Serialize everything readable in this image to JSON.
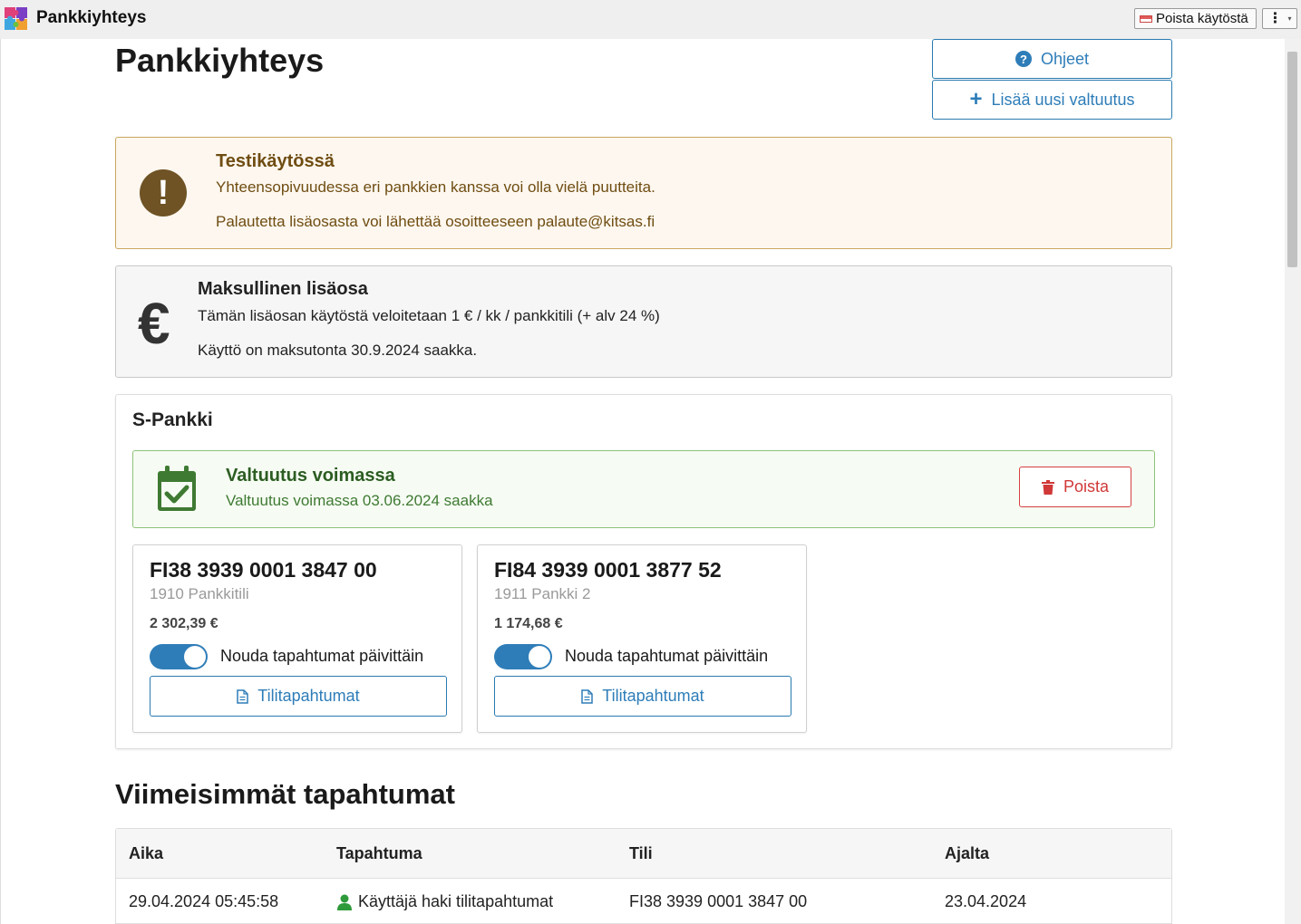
{
  "window": {
    "title": "Pankkiyhteys",
    "disable_label": "Poista käytöstä",
    "menu_dots": "⋮",
    "menu_caret": "▾"
  },
  "page": {
    "title": "Pankkiyhteys",
    "help_button": "Ohjeet",
    "add_button": "Lisää uusi valtuutus"
  },
  "warning": {
    "title": "Testikäytössä",
    "line1": "Yhteensopivuudessa eri pankkien kanssa voi olla vielä puutteita.",
    "line2": "Palautetta lisäosasta voi lähettää osoitteeseen palaute@kitsas.fi",
    "icon": "exclamation-icon",
    "icon_glyph": "!"
  },
  "info": {
    "title": "Maksullinen lisäosa",
    "line1": "Tämän lisäosan käytöstä veloitetaan 1 € / kk / pankkitili (+ alv 24 %)",
    "line2": "Käyttö on maksutonta 30.9.2024 saakka.",
    "icon": "euro-icon",
    "icon_glyph": "€"
  },
  "bank": {
    "name": "S-Pankki",
    "authorization": {
      "title": "Valtuutus voimassa",
      "subtitle": "Valtuutus voimassa 03.06.2024 saakka",
      "delete_label": "Poista"
    },
    "accounts": [
      {
        "iban": "FI38 3939 0001 3847 00",
        "name": "1910 Pankkitili",
        "balance": "2 302,39 €",
        "fetch_daily": true,
        "toggle_label": "Nouda tapahtumat päivittäin",
        "transactions_label": "Tilitapahtumat"
      },
      {
        "iban": "FI84 3939 0001 3877 52",
        "name": "1911 Pankki 2",
        "balance": "1 174,68 €",
        "fetch_daily": true,
        "toggle_label": "Nouda tapahtumat päivittäin",
        "transactions_label": "Tilitapahtumat"
      }
    ]
  },
  "events": {
    "title": "Viimeisimmät tapahtumat",
    "columns": [
      "Aika",
      "Tapahtuma",
      "Tili",
      "Ajalta"
    ],
    "rows": [
      {
        "time": "29.04.2024 05:45:58",
        "event": "Käyttäjä haki tilitapahtumat",
        "account": "FI38 3939 0001 3847 00",
        "period": "23.04.2024"
      }
    ]
  },
  "colors": {
    "accent": "#2e7db8",
    "warning_bg": "#fdf7ef",
    "warning_text": "#6f4d12",
    "success_bg": "#f6fcf3",
    "success_text": "#2c5d22",
    "danger": "#d13838"
  }
}
